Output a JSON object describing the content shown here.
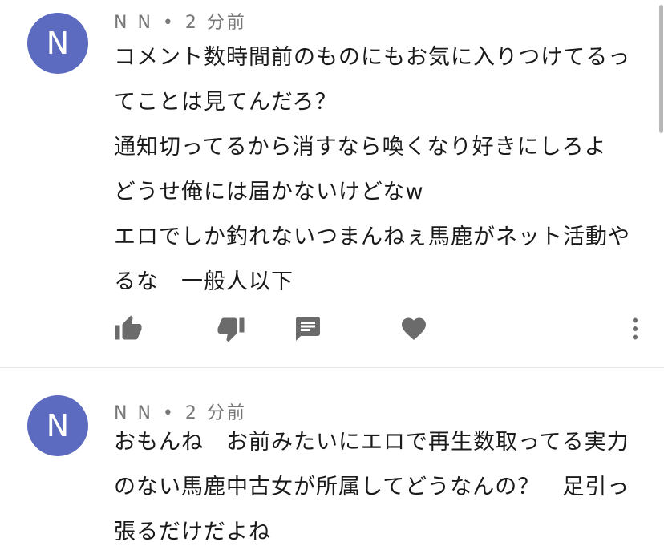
{
  "comments": [
    {
      "avatar_letter": "N",
      "author": "N N",
      "separator": "•",
      "time": "2 分前",
      "lines": [
        "コメント数時間前のものにもお気に入りつけてるっ",
        "てことは見てんだろ？",
        "通知切ってるから消すなら喚くなり好きにしろよ",
        "どうせ俺には届かないけどなw",
        "エロでしか釣れないつまんねぇ馬鹿がネット活動や",
        "るな　一般人以下"
      ],
      "actions": {
        "like_icon": "thumb-up-icon",
        "dislike_icon": "thumb-down-icon",
        "reply_icon": "reply-comment-icon",
        "heart_icon": "heart-icon",
        "more_icon": "more-vertical-icon"
      }
    },
    {
      "avatar_letter": "N",
      "author": "N N",
      "separator": "•",
      "time": "2 分前",
      "lines": [
        "おもんね　お前みたいにエロで再生数取ってる実力",
        "のない馬鹿中古女が所属してどうなんの？　足引っ",
        "張るだけだよね"
      ]
    }
  ],
  "colors": {
    "avatar_bg": "#5c6bc0",
    "meta_text": "#777777",
    "body_text": "#1a1a1a",
    "icon": "#6b6b6b"
  }
}
